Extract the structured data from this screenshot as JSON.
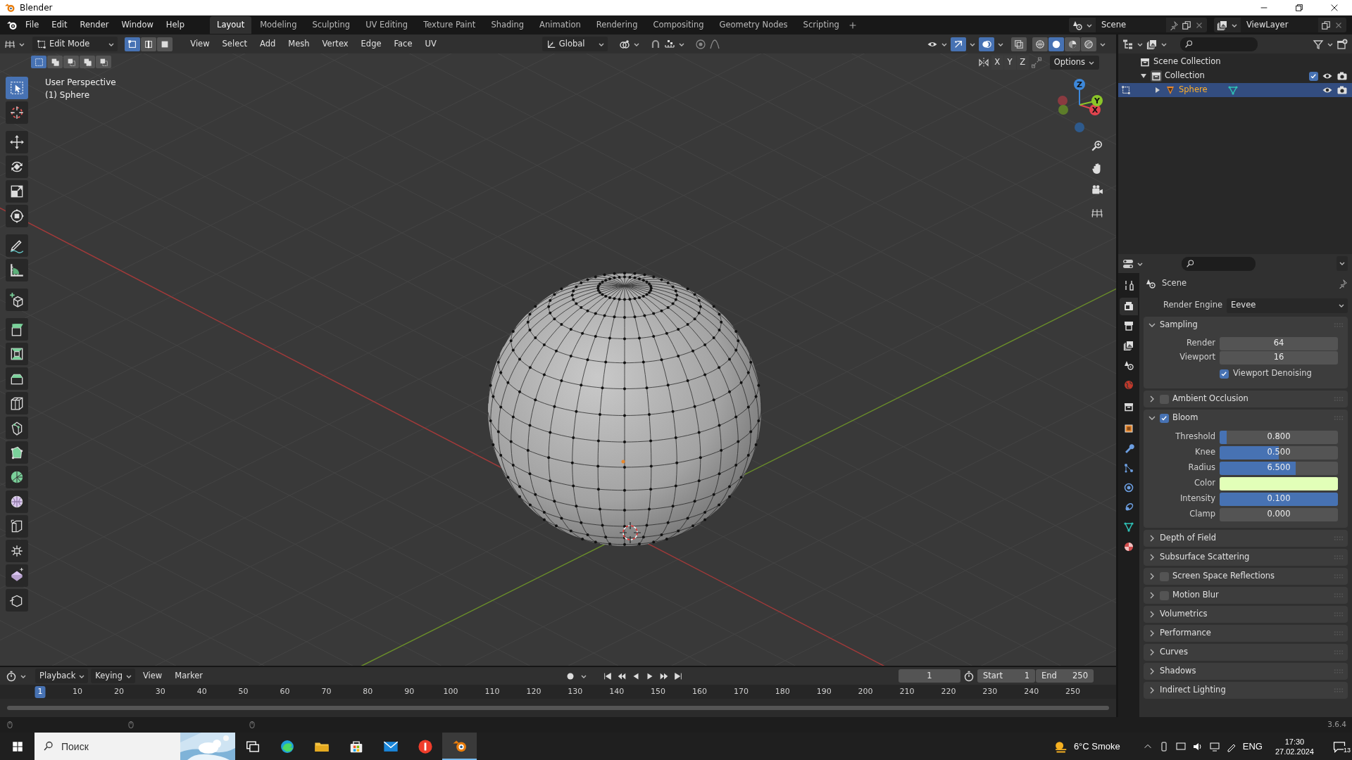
{
  "window": {
    "title": "Blender"
  },
  "menu": [
    "File",
    "Edit",
    "Render",
    "Window",
    "Help"
  ],
  "workspaces": [
    {
      "label": "Layout",
      "selected": true
    },
    {
      "label": "Modeling",
      "selected": false
    },
    {
      "label": "Sculpting",
      "selected": false
    },
    {
      "label": "UV Editing",
      "selected": false
    },
    {
      "label": "Texture Paint",
      "selected": false
    },
    {
      "label": "Shading",
      "selected": false
    },
    {
      "label": "Animation",
      "selected": false
    },
    {
      "label": "Rendering",
      "selected": false
    },
    {
      "label": "Compositing",
      "selected": false
    },
    {
      "label": "Geometry Nodes",
      "selected": false
    },
    {
      "label": "Scripting",
      "selected": false
    }
  ],
  "scene_selector": {
    "value": "Scene"
  },
  "view_layer_selector": {
    "value": "ViewLayer"
  },
  "viewport_header": {
    "mode": "Edit Mode",
    "select_modes": [
      {
        "selected": true
      },
      {
        "selected": false
      },
      {
        "selected": false
      }
    ],
    "menus": [
      "View",
      "Select",
      "Add",
      "Mesh",
      "Vertex",
      "Edge",
      "Face",
      "UV"
    ],
    "orientation": "Global",
    "gizmos_on": true,
    "overlays_on": true,
    "shading_modes": [
      {
        "selected": false
      },
      {
        "selected": true
      },
      {
        "selected": false
      },
      {
        "selected": false
      }
    ]
  },
  "tool_settings": {
    "select_box_modes": [
      {
        "selected": true
      },
      {
        "selected": false
      },
      {
        "selected": false
      },
      {
        "selected": false
      },
      {
        "selected": false
      }
    ],
    "mirror_axes": [
      {
        "label": "X",
        "on": false
      },
      {
        "label": "Y",
        "on": false
      },
      {
        "label": "Z",
        "on": false
      }
    ],
    "options": "Options"
  },
  "viewport": {
    "view_name": "User Perspective",
    "object_name": "(1) Sphere",
    "gizmo_axes": [
      "X",
      "Y",
      "Z"
    ]
  },
  "toolbar": [
    {
      "kind": "select",
      "selected": true
    },
    {
      "kind": "cursor",
      "selected": false
    },
    {
      "kind": "move",
      "selected": false
    },
    {
      "kind": "rotate",
      "selected": false
    },
    {
      "kind": "scale",
      "selected": false
    },
    {
      "kind": "transform",
      "selected": false
    },
    {
      "kind": "annotate",
      "selected": false
    },
    {
      "kind": "measure",
      "selected": false
    },
    {
      "kind": "add_cube",
      "selected": false
    },
    {
      "kind": "extrude",
      "selected": false
    },
    {
      "kind": "inset",
      "selected": false
    },
    {
      "kind": "bevel",
      "selected": false
    },
    {
      "kind": "loop_cut",
      "selected": false
    },
    {
      "kind": "knife",
      "selected": false
    },
    {
      "kind": "poly_build",
      "selected": false
    },
    {
      "kind": "spin",
      "selected": false
    },
    {
      "kind": "smooth",
      "selected": false
    },
    {
      "kind": "edge_slide",
      "selected": false
    },
    {
      "kind": "shrink",
      "selected": false
    },
    {
      "kind": "shear",
      "selected": false
    },
    {
      "kind": "rip",
      "selected": false
    }
  ],
  "outliner": {
    "tree": [
      {
        "kind": "scene_collection",
        "label": "Scene Collection",
        "children": [
          {
            "kind": "collection",
            "label": "Collection",
            "expanded": true,
            "checked": true,
            "visible": true,
            "renderable": true,
            "children": [
              {
                "kind": "mesh_object",
                "label": "Sphere",
                "expanded": false,
                "selected": true,
                "visible": true,
                "renderable": true
              }
            ]
          }
        ]
      }
    ]
  },
  "properties": {
    "tabs": [
      {
        "kind": "tool",
        "selected": false
      },
      {
        "kind": "render",
        "selected": true
      },
      {
        "kind": "output",
        "selected": false
      },
      {
        "kind": "view_layer",
        "selected": false
      },
      {
        "kind": "scene",
        "selected": false
      },
      {
        "kind": "world",
        "selected": false
      },
      {
        "kind": "collection",
        "selected": false
      },
      {
        "kind": "object",
        "selected": false
      },
      {
        "kind": "modifiers",
        "selected": false
      },
      {
        "kind": "particles",
        "selected": false
      },
      {
        "kind": "physics",
        "selected": false
      },
      {
        "kind": "constraints",
        "selected": false
      },
      {
        "kind": "data",
        "selected": false
      },
      {
        "kind": "material",
        "selected": false
      }
    ],
    "context": "Scene",
    "render_engine_label": "Render Engine",
    "render_engine": "Eevee",
    "panels": [
      {
        "title": "Sampling",
        "expanded": true,
        "fields": [
          {
            "kind": "number",
            "label": "Render",
            "value": "64"
          },
          {
            "kind": "number",
            "label": "Viewport",
            "value": "16"
          },
          {
            "kind": "checkbox",
            "label": "Viewport Denoising",
            "checked": true
          }
        ]
      },
      {
        "title": "Ambient Occlusion",
        "expanded": false,
        "checked": false
      },
      {
        "title": "Bloom",
        "expanded": true,
        "checked": true,
        "fields": [
          {
            "kind": "slider",
            "label": "Threshold",
            "value": "0.800",
            "level": 0.06
          },
          {
            "kind": "slider",
            "label": "Knee",
            "value": "0.500",
            "level": 0.5
          },
          {
            "kind": "slider",
            "label": "Radius",
            "value": "6.500",
            "level": 0.64
          },
          {
            "kind": "color",
            "label": "Color",
            "color": "#e2ffb8"
          },
          {
            "kind": "slider",
            "label": "Intensity",
            "value": "0.100",
            "level": 1
          },
          {
            "kind": "number",
            "label": "Clamp",
            "value": "0.000"
          }
        ]
      },
      {
        "title": "Depth of Field",
        "expanded": false
      },
      {
        "title": "Subsurface Scattering",
        "expanded": false
      },
      {
        "title": "Screen Space Reflections",
        "expanded": false,
        "checked": false
      },
      {
        "title": "Motion Blur",
        "expanded": false,
        "checked": false
      },
      {
        "title": "Volumetrics",
        "expanded": false
      },
      {
        "title": "Performance",
        "expanded": false
      },
      {
        "title": "Curves",
        "expanded": false
      },
      {
        "title": "Shadows",
        "expanded": false
      },
      {
        "title": "Indirect Lighting",
        "expanded": false
      }
    ]
  },
  "timeline": {
    "menus": [
      "Playback",
      "Keying",
      "View",
      "Marker"
    ],
    "current_frame": "1",
    "start_label": "Start",
    "start": "1",
    "end_label": "End",
    "end": "250",
    "ruler": [
      {
        "label": "1",
        "selected": true
      },
      {
        "label": "10",
        "selected": false
      },
      {
        "label": "20",
        "selected": false
      },
      {
        "label": "30",
        "selected": false
      },
      {
        "label": "40",
        "selected": false
      },
      {
        "label": "50",
        "selected": false
      },
      {
        "label": "60",
        "selected": false
      },
      {
        "label": "70",
        "selected": false
      },
      {
        "label": "80",
        "selected": false
      },
      {
        "label": "90",
        "selected": false
      },
      {
        "label": "100",
        "selected": false
      },
      {
        "label": "110",
        "selected": false
      },
      {
        "label": "120",
        "selected": false
      },
      {
        "label": "130",
        "selected": false
      },
      {
        "label": "140",
        "selected": false
      },
      {
        "label": "150",
        "selected": false
      },
      {
        "label": "160",
        "selected": false
      },
      {
        "label": "170",
        "selected": false
      },
      {
        "label": "180",
        "selected": false
      },
      {
        "label": "190",
        "selected": false
      },
      {
        "label": "200",
        "selected": false
      },
      {
        "label": "210",
        "selected": false
      },
      {
        "label": "220",
        "selected": false
      },
      {
        "label": "230",
        "selected": false
      },
      {
        "label": "240",
        "selected": false
      },
      {
        "label": "250",
        "selected": false
      }
    ]
  },
  "status_bar": {
    "version": "3.6.4"
  },
  "taskbar": {
    "search_placeholder": "Поиск",
    "weather": "6°C Smoke",
    "language": "ENG",
    "time": "17:30",
    "date": "27.02.2024",
    "notifications": "13"
  }
}
